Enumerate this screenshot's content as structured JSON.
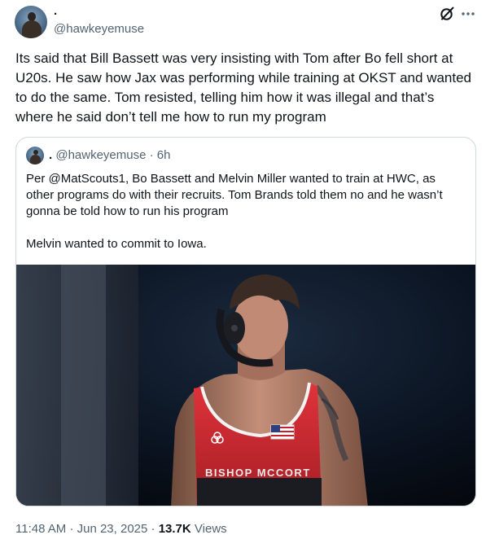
{
  "author": {
    "display_name": ".",
    "handle": "@hawkeyemuse"
  },
  "tweet": {
    "text": "Its said that Bill Bassett was very insisting with Tom after Bo fell short at U20s. He saw how Jax was performing while training at OKST and wanted to do the same. Tom resisted, telling him how it was illegal and that’s where he said don’t tell me how to run my program"
  },
  "quoted_tweet": {
    "display_name": ".",
    "handle": "@hawkeyemuse",
    "separator": "·",
    "time": "6h",
    "paragraphs": [
      "Per @MatScouts1, Bo Bassett and Melvin Miller wanted to train at HWC, as other programs do with their recruits. Tom Brands told them no and he wasn’t gonna be told how to run his program",
      "Melvin wanted to commit to Iowa."
    ],
    "photo": {
      "singlet_text": "BISHOP MCCORT"
    }
  },
  "footer": {
    "time": "11:48 AM",
    "separator": "·",
    "date": "Jun 23, 2025",
    "separator2": "·",
    "views_count": "13.7K",
    "views_label": "Views"
  },
  "icons": {
    "grok": "grok-icon",
    "more": "more-icon"
  },
  "colors": {
    "text_primary": "#0f1419",
    "text_secondary": "#536471",
    "border": "#cfd9de",
    "singlet_red": "#d42a32"
  }
}
